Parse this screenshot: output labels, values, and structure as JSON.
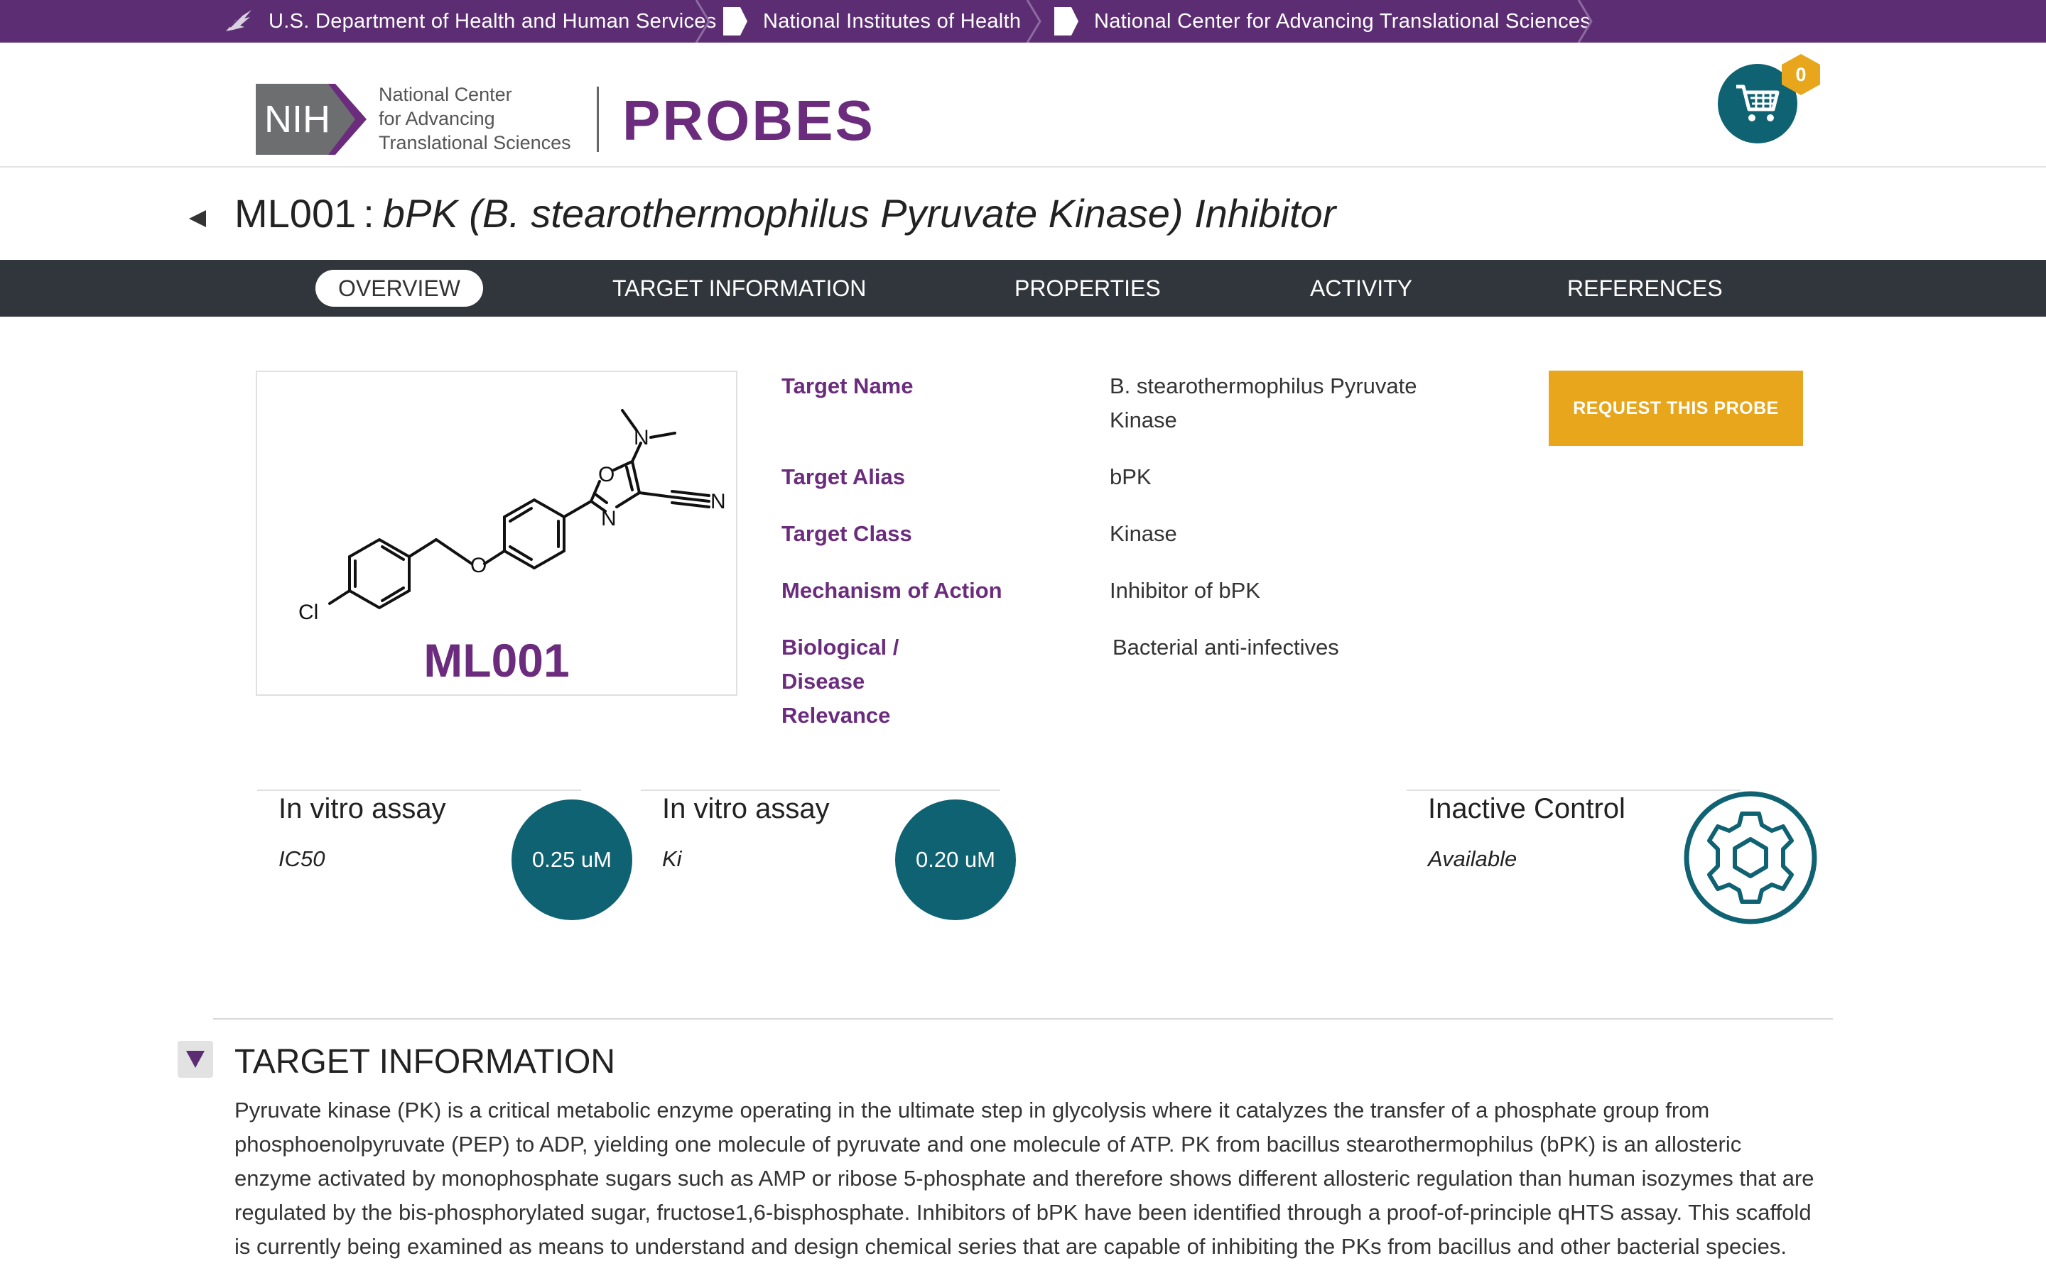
{
  "breadcrumbs": [
    {
      "label": "U.S. Department of Health and Human Services",
      "icon": "hhs-eagle-icon"
    },
    {
      "label": "National Institutes of Health",
      "icon": "document-icon"
    },
    {
      "label": "National Center for Advancing Translational Sciences",
      "icon": "document-icon"
    }
  ],
  "header": {
    "nih_logo_text": "NIH",
    "ncats_lines": [
      "National Center",
      "for Advancing",
      "Translational Sciences"
    ],
    "site_name": "PROBES",
    "cart_count": "0"
  },
  "title": {
    "code": "ML001",
    "separator": ":",
    "name": "bPK (B. stearothermophilus Pyruvate Kinase) Inhibitor"
  },
  "tabs": [
    {
      "label": "OVERVIEW",
      "active": true
    },
    {
      "label": "TARGET INFORMATION",
      "active": false
    },
    {
      "label": "PROPERTIES",
      "active": false
    },
    {
      "label": "ACTIVITY",
      "active": false
    },
    {
      "label": "REFERENCES",
      "active": false
    }
  ],
  "structure": {
    "label": "ML001",
    "atoms": [
      "Cl",
      "O",
      "O",
      "N",
      "N",
      "N"
    ]
  },
  "properties": [
    {
      "key": "Target Name",
      "value": "B. stearothermophilus Pyruvate Kinase"
    },
    {
      "key": "Target Alias",
      "value": "bPK"
    },
    {
      "key": "Target Class",
      "value": "Kinase"
    },
    {
      "key": "Mechanism of Action",
      "value": "Inhibitor of bPK"
    },
    {
      "key": "Biological / Disease Relevance",
      "value": "Bacterial anti-infectives"
    }
  ],
  "request_button": "REQUEST THIS PROBE",
  "assays": [
    {
      "title": "In vitro assay",
      "subtitle": "IC50",
      "value": "0.25 uM"
    },
    {
      "title": "In vitro assay",
      "subtitle": "Ki",
      "value": "0.20 uM"
    }
  ],
  "inactive_control": {
    "title": "Inactive Control",
    "subtitle": "Available",
    "icon": "gear-icon"
  },
  "target_section": {
    "title": "TARGET INFORMATION",
    "body": "Pyruvate kinase (PK) is a critical metabolic enzyme operating in the ultimate step in glycolysis where it catalyzes the transfer of a phosphate group from phosphoenolpyruvate (PEP) to ADP, yielding one molecule of pyruvate and one molecule of ATP. PK from bacillus stearothermophilus (bPK) is an allosteric enzyme activated by monophosphate sugars such as AMP or ribose 5-phosphate and therefore shows different allosteric regulation than human isozymes that are regulated by the bis-phosphorylated sugar, fructose1,6-bisphosphate. Inhibitors of bPK have been identified through a proof-of-principle qHTS assay. This scaffold is currently being examined as means to understand and design chemical series that are capable of inhibiting the PKs from bacillus and other bacterial species."
  },
  "colors": {
    "purple": "#5c2d73",
    "brand_purple": "#6b2c7e",
    "nav_dark": "#31363d",
    "teal": "#0f6272",
    "orange": "#e8a61c"
  }
}
